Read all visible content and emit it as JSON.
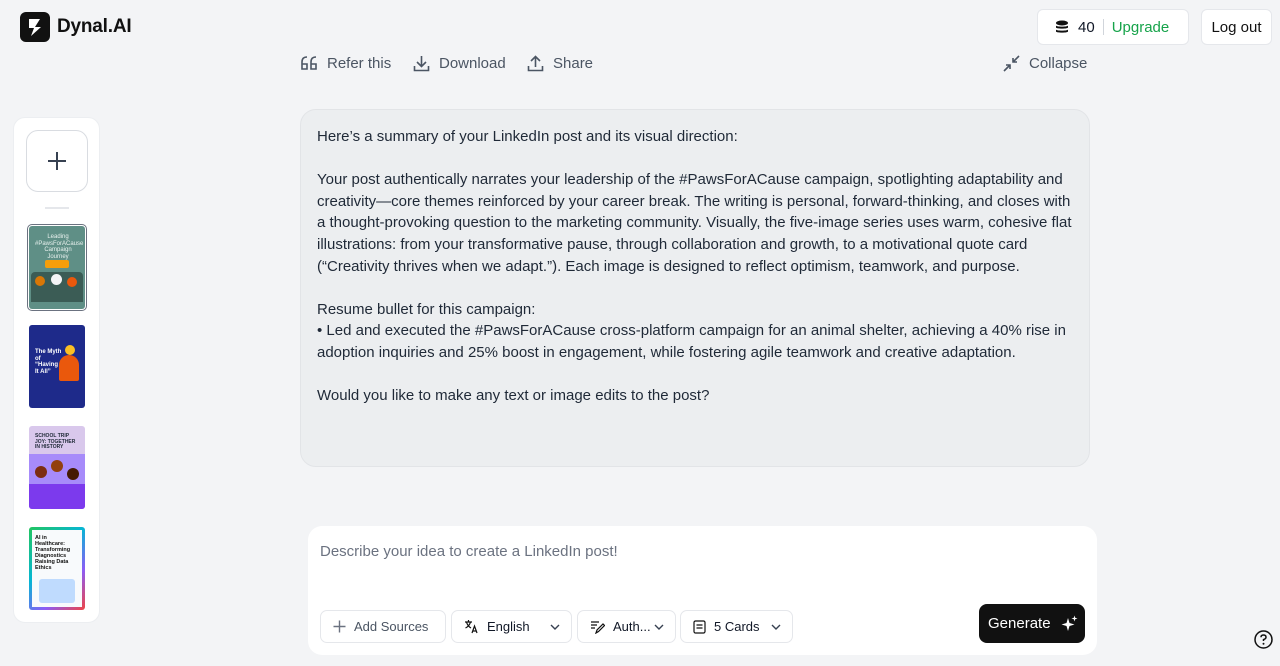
{
  "app": {
    "name": "Dynal.AI"
  },
  "header": {
    "credits": "40",
    "upgrade_label": "Upgrade",
    "logout_label": "Log out"
  },
  "toolbar": {
    "refer_label": "Refer this",
    "download_label": "Download",
    "share_label": "Share",
    "collapse_label": "Collapse"
  },
  "sidebar": {
    "thumbnails": [
      {
        "text": "Leading #PawsForACause Campaign Journey",
        "bg": "#5f8f86",
        "selected": true
      },
      {
        "text": "The Myth of “Having It All”",
        "bg": "#1e2a8a",
        "selected": false
      },
      {
        "text": "SCHOOL TRIP JOY: TOGETHER IN HISTORY",
        "bg": "#d9c8ec",
        "selected": false
      },
      {
        "text": "AI in Healthcare: Transforming Diagnostics Raising Data Ethics",
        "bg": "#f2f2f2",
        "selected": false
      }
    ]
  },
  "message": {
    "intro": "Here’s a summary of your LinkedIn post and its visual direction:",
    "summary": "Your post authentically narrates your leadership of the #PawsForACause campaign, spotlighting adaptability and creativity—core themes reinforced by your career break. The writing is personal, forward-thinking, and closes with a thought-provoking question to the marketing community. Visually, the five-image series uses warm, cohesive flat illustrations: from your transformative pause, through collaboration and growth, to a motivational quote card (“Creativity thrives when we adapt.”). Each image is designed to reflect optimism, teamwork, and purpose.",
    "resume_heading": "Resume bullet for this campaign:",
    "resume_bullet": "• Led and executed the #PawsForACause cross-platform campaign for an animal shelter, achieving a 40% rise in adoption inquiries and 25% boost in engagement, while fostering agile teamwork and creative adaptation.",
    "question": "Would you like to make any text or image edits to the post?"
  },
  "composer": {
    "placeholder": "Describe your idea to create a LinkedIn post!",
    "add_sources_label": "Add Sources",
    "language": "English",
    "tone": "Auth...",
    "cards": "5 Cards",
    "generate_label": "Generate"
  },
  "colors": {
    "accent_green": "#16a34a",
    "dark_button": "#111111"
  }
}
